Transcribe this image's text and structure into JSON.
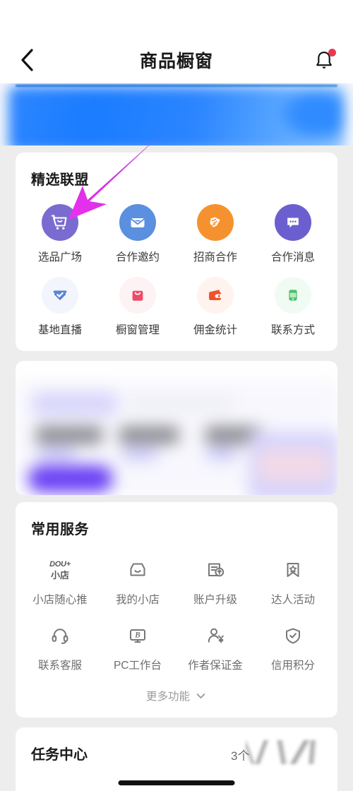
{
  "header": {
    "title": "商品橱窗",
    "back_icon": "chevron-left-icon",
    "bell_icon": "bell-icon",
    "has_notification_dot": true
  },
  "banner": {
    "state": "blurred-promotional-banner",
    "color": "#1a7cff"
  },
  "alliance": {
    "title": "精选联盟",
    "items": [
      {
        "label": "选品广场",
        "icon": "shopping-cart-icon",
        "bg": "#7A6BD0",
        "fg": "#ffffff",
        "style": "solid"
      },
      {
        "label": "合作邀约",
        "icon": "envelope-icon",
        "bg": "#5B8FE0",
        "fg": "#ffffff",
        "style": "solid"
      },
      {
        "label": "招商合作",
        "icon": "handshake-icon",
        "bg": "#F5922F",
        "fg": "#ffffff",
        "style": "solid"
      },
      {
        "label": "合作消息",
        "icon": "chat-bubble-icon",
        "bg": "#6B5FD0",
        "fg": "#ffffff",
        "style": "solid"
      },
      {
        "label": "基地直播",
        "icon": "shield-check-icon",
        "bg": "#F3F6FC",
        "fg": "#5B84D8",
        "style": "tint"
      },
      {
        "label": "橱窗管理",
        "icon": "shopping-bag-icon",
        "bg": "#FDF3F5",
        "fg": "#EE4B68",
        "style": "tint"
      },
      {
        "label": "佣金统计",
        "icon": "wallet-icon",
        "bg": "#FEF4F0",
        "fg": "#F1522A",
        "style": "tint"
      },
      {
        "label": "联系方式",
        "icon": "phone-contact-icon",
        "bg": "#F1FBF4",
        "fg": "#4CC06A",
        "style": "tint"
      }
    ]
  },
  "promo": {
    "state": "blurred-promotional-card",
    "button_color": "#6A41F5"
  },
  "services": {
    "title": "常用服务",
    "items": [
      {
        "label": "小店随心推",
        "icon": "dou-plus-store-icon",
        "logo_top": "DOU+",
        "logo_bottom": "小店"
      },
      {
        "label": "我的小店",
        "icon": "storefront-icon"
      },
      {
        "label": "账户升级",
        "icon": "account-upgrade-icon"
      },
      {
        "label": "达人活动",
        "icon": "star-bookmark-icon"
      },
      {
        "label": "联系客服",
        "icon": "headset-icon"
      },
      {
        "label": "PC工作台",
        "icon": "monitor-b-icon"
      },
      {
        "label": "作者保证金",
        "icon": "person-yuan-icon"
      },
      {
        "label": "信用积分",
        "icon": "shield-check-outline-icon"
      }
    ],
    "more_label": "更多功能",
    "more_icon": "chevron-down-icon"
  },
  "task_center": {
    "title": "任务中心",
    "count_text": "3个",
    "watermark": "blurred-watermark"
  },
  "annotation": {
    "arrow_color_start": "#C736E0",
    "arrow_color_end": "#E633E6",
    "points_to": "选品广场"
  }
}
